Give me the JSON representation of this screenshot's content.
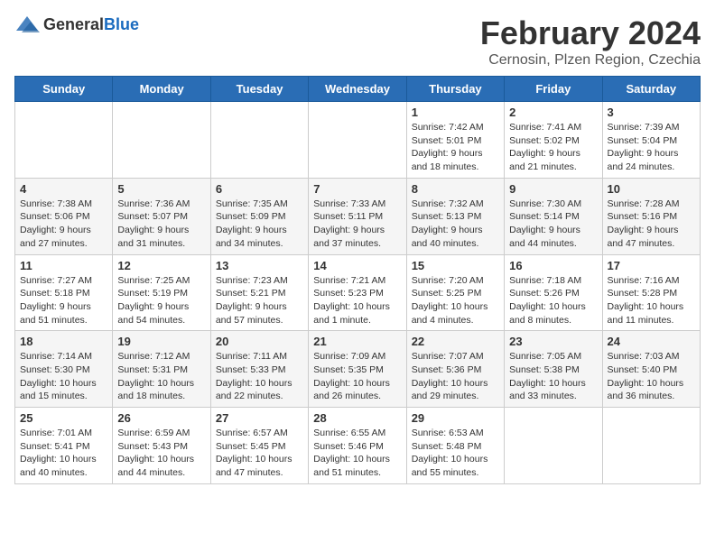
{
  "header": {
    "logo_general": "General",
    "logo_blue": "Blue",
    "month_title": "February 2024",
    "location": "Cernosin, Plzen Region, Czechia"
  },
  "weekdays": [
    "Sunday",
    "Monday",
    "Tuesday",
    "Wednesday",
    "Thursday",
    "Friday",
    "Saturday"
  ],
  "weeks": [
    [
      {
        "day": "",
        "info": ""
      },
      {
        "day": "",
        "info": ""
      },
      {
        "day": "",
        "info": ""
      },
      {
        "day": "",
        "info": ""
      },
      {
        "day": "1",
        "info": "Sunrise: 7:42 AM\nSunset: 5:01 PM\nDaylight: 9 hours\nand 18 minutes."
      },
      {
        "day": "2",
        "info": "Sunrise: 7:41 AM\nSunset: 5:02 PM\nDaylight: 9 hours\nand 21 minutes."
      },
      {
        "day": "3",
        "info": "Sunrise: 7:39 AM\nSunset: 5:04 PM\nDaylight: 9 hours\nand 24 minutes."
      }
    ],
    [
      {
        "day": "4",
        "info": "Sunrise: 7:38 AM\nSunset: 5:06 PM\nDaylight: 9 hours\nand 27 minutes."
      },
      {
        "day": "5",
        "info": "Sunrise: 7:36 AM\nSunset: 5:07 PM\nDaylight: 9 hours\nand 31 minutes."
      },
      {
        "day": "6",
        "info": "Sunrise: 7:35 AM\nSunset: 5:09 PM\nDaylight: 9 hours\nand 34 minutes."
      },
      {
        "day": "7",
        "info": "Sunrise: 7:33 AM\nSunset: 5:11 PM\nDaylight: 9 hours\nand 37 minutes."
      },
      {
        "day": "8",
        "info": "Sunrise: 7:32 AM\nSunset: 5:13 PM\nDaylight: 9 hours\nand 40 minutes."
      },
      {
        "day": "9",
        "info": "Sunrise: 7:30 AM\nSunset: 5:14 PM\nDaylight: 9 hours\nand 44 minutes."
      },
      {
        "day": "10",
        "info": "Sunrise: 7:28 AM\nSunset: 5:16 PM\nDaylight: 9 hours\nand 47 minutes."
      }
    ],
    [
      {
        "day": "11",
        "info": "Sunrise: 7:27 AM\nSunset: 5:18 PM\nDaylight: 9 hours\nand 51 minutes."
      },
      {
        "day": "12",
        "info": "Sunrise: 7:25 AM\nSunset: 5:19 PM\nDaylight: 9 hours\nand 54 minutes."
      },
      {
        "day": "13",
        "info": "Sunrise: 7:23 AM\nSunset: 5:21 PM\nDaylight: 9 hours\nand 57 minutes."
      },
      {
        "day": "14",
        "info": "Sunrise: 7:21 AM\nSunset: 5:23 PM\nDaylight: 10 hours\nand 1 minute."
      },
      {
        "day": "15",
        "info": "Sunrise: 7:20 AM\nSunset: 5:25 PM\nDaylight: 10 hours\nand 4 minutes."
      },
      {
        "day": "16",
        "info": "Sunrise: 7:18 AM\nSunset: 5:26 PM\nDaylight: 10 hours\nand 8 minutes."
      },
      {
        "day": "17",
        "info": "Sunrise: 7:16 AM\nSunset: 5:28 PM\nDaylight: 10 hours\nand 11 minutes."
      }
    ],
    [
      {
        "day": "18",
        "info": "Sunrise: 7:14 AM\nSunset: 5:30 PM\nDaylight: 10 hours\nand 15 minutes."
      },
      {
        "day": "19",
        "info": "Sunrise: 7:12 AM\nSunset: 5:31 PM\nDaylight: 10 hours\nand 18 minutes."
      },
      {
        "day": "20",
        "info": "Sunrise: 7:11 AM\nSunset: 5:33 PM\nDaylight: 10 hours\nand 22 minutes."
      },
      {
        "day": "21",
        "info": "Sunrise: 7:09 AM\nSunset: 5:35 PM\nDaylight: 10 hours\nand 26 minutes."
      },
      {
        "day": "22",
        "info": "Sunrise: 7:07 AM\nSunset: 5:36 PM\nDaylight: 10 hours\nand 29 minutes."
      },
      {
        "day": "23",
        "info": "Sunrise: 7:05 AM\nSunset: 5:38 PM\nDaylight: 10 hours\nand 33 minutes."
      },
      {
        "day": "24",
        "info": "Sunrise: 7:03 AM\nSunset: 5:40 PM\nDaylight: 10 hours\nand 36 minutes."
      }
    ],
    [
      {
        "day": "25",
        "info": "Sunrise: 7:01 AM\nSunset: 5:41 PM\nDaylight: 10 hours\nand 40 minutes."
      },
      {
        "day": "26",
        "info": "Sunrise: 6:59 AM\nSunset: 5:43 PM\nDaylight: 10 hours\nand 44 minutes."
      },
      {
        "day": "27",
        "info": "Sunrise: 6:57 AM\nSunset: 5:45 PM\nDaylight: 10 hours\nand 47 minutes."
      },
      {
        "day": "28",
        "info": "Sunrise: 6:55 AM\nSunset: 5:46 PM\nDaylight: 10 hours\nand 51 minutes."
      },
      {
        "day": "29",
        "info": "Sunrise: 6:53 AM\nSunset: 5:48 PM\nDaylight: 10 hours\nand 55 minutes."
      },
      {
        "day": "",
        "info": ""
      },
      {
        "day": "",
        "info": ""
      }
    ]
  ]
}
